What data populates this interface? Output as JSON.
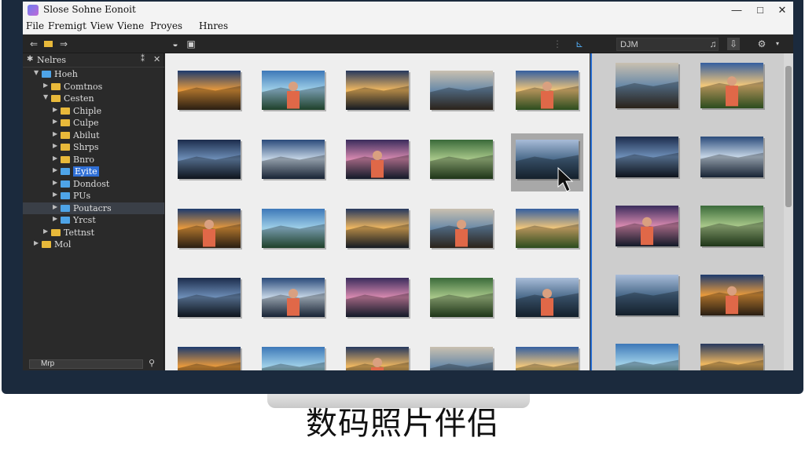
{
  "window": {
    "title": "Slose Sohne Eonoit",
    "minimize": "—",
    "maximize": "□",
    "close": "✕"
  },
  "menu": [
    "File",
    "Fremigt",
    "View",
    "Viene",
    "Proyes",
    "Hnres"
  ],
  "toolbar": {
    "path_value": "DJM",
    "icons": [
      "back-arrow",
      "folder",
      "forward-arrow",
      "home",
      "split-view",
      "sort",
      "bell",
      "download",
      "gear"
    ]
  },
  "tree": {
    "header": "Nelres",
    "items": [
      {
        "label": "Hoeh",
        "indent": 0,
        "expanded": true,
        "color": "blue"
      },
      {
        "label": "Comtnos",
        "indent": 1,
        "expanded": false,
        "color": "yellow"
      },
      {
        "label": "Cesten",
        "indent": 1,
        "expanded": true,
        "color": "yellow"
      },
      {
        "label": "Chiple",
        "indent": 2,
        "expanded": false,
        "color": "yellow"
      },
      {
        "label": "Culpe",
        "indent": 2,
        "expanded": false,
        "color": "yellow"
      },
      {
        "label": "Abilut",
        "indent": 2,
        "expanded": false,
        "color": "yellow"
      },
      {
        "label": "Shrps",
        "indent": 2,
        "expanded": false,
        "color": "yellow"
      },
      {
        "label": "Bnro",
        "indent": 2,
        "expanded": false,
        "color": "yellow"
      },
      {
        "label": "Eyite",
        "indent": 2,
        "expanded": false,
        "color": "blue",
        "selected": true
      },
      {
        "label": "Dondost",
        "indent": 2,
        "expanded": false,
        "color": "blue"
      },
      {
        "label": "PUs",
        "indent": 2,
        "expanded": false,
        "color": "blue"
      },
      {
        "label": "Poutacrs",
        "indent": 2,
        "expanded": false,
        "color": "blue",
        "highlighted": true
      },
      {
        "label": "Yrcst",
        "indent": 2,
        "expanded": false,
        "color": "blue"
      },
      {
        "label": "Tettnst",
        "indent": 1,
        "expanded": false,
        "color": "yellow"
      },
      {
        "label": "Mol",
        "indent": 0,
        "expanded": false,
        "color": "yellow"
      }
    ],
    "search_value": "Mrp"
  },
  "caption": "数码照片伴侣",
  "colors": {
    "accent": "#2a6fd2",
    "folder": "#e8b93a",
    "folder_blue": "#4ea4e8"
  },
  "thumbs": {
    "main_grid": [
      [
        "sunset-field",
        "lake-portrait",
        "road-sunset",
        "stacked-photos",
        "sky-field"
      ],
      [
        "twilight-lake",
        "calm-lake",
        "purple-sky",
        "girl-field",
        "selected-lake"
      ],
      [
        "sunrise-lake",
        "road-field",
        "mountain-lake-portrait",
        "beach-person",
        "tree-path"
      ],
      [
        "two-girls",
        "corridor",
        "mountain-person",
        "field-road",
        "girl-seaside"
      ],
      [
        "blue-dusk",
        "man-portrait",
        "mountain-lake",
        "girl-street",
        "blue-road"
      ]
    ],
    "side_grid": [
      [
        "forest-girl",
        "woman-meadow"
      ],
      [
        "sunset-boat",
        "lake-rowboat"
      ],
      [
        "dusk-lake",
        "woman-closeup"
      ],
      [
        "pier-sunset",
        "girl-beach"
      ],
      [
        "sunrise-road",
        "cliff-sunset"
      ]
    ]
  }
}
